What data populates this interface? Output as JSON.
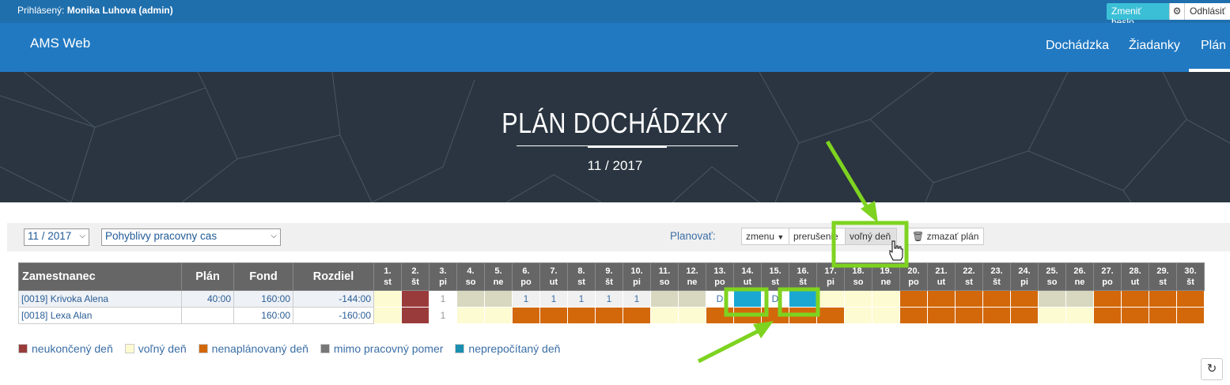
{
  "topbar": {
    "login_prefix": "Prihlásený:",
    "login_user": "Monika Luhova (admin)",
    "change_password": "Zmeniť heslo",
    "logout": "Odhlásiť"
  },
  "navbar": {
    "brand": "AMS Web",
    "items": [
      "Dochádzka",
      "Žiadanky",
      "Plán"
    ]
  },
  "hero": {
    "title": "PLÁN DOCHÁDZKY",
    "subtitle": "11 / 2017"
  },
  "filters": {
    "month": "11 / 2017",
    "schedule": "Pohyblivy pracovny cas",
    "plan_label": "Planovať:",
    "buttons": [
      "zmenu",
      "prerušenie",
      "voľný deň"
    ],
    "clear_plan": "zmazať plán"
  },
  "table": {
    "headers": {
      "employee": "Zamestnanec",
      "plan": "Plán",
      "fund": "Fond",
      "diff": "Rozdiel"
    },
    "days": [
      [
        "1.",
        "st"
      ],
      [
        "2.",
        "št"
      ],
      [
        "3.",
        "pi"
      ],
      [
        "4.",
        "so"
      ],
      [
        "5.",
        "ne"
      ],
      [
        "6.",
        "po"
      ],
      [
        "7.",
        "ut"
      ],
      [
        "8.",
        "st"
      ],
      [
        "9.",
        "št"
      ],
      [
        "10.",
        "pi"
      ],
      [
        "11.",
        "so"
      ],
      [
        "12.",
        "ne"
      ],
      [
        "13.",
        "po"
      ],
      [
        "14.",
        "ut"
      ],
      [
        "15.",
        "st"
      ],
      [
        "16.",
        "št"
      ],
      [
        "17.",
        "pi"
      ],
      [
        "18.",
        "so"
      ],
      [
        "19.",
        "ne"
      ],
      [
        "20.",
        "po"
      ],
      [
        "21.",
        "ut"
      ],
      [
        "22.",
        "st"
      ],
      [
        "23.",
        "št"
      ],
      [
        "24.",
        "pi"
      ],
      [
        "25.",
        "so"
      ],
      [
        "26.",
        "ne"
      ],
      [
        "27.",
        "po"
      ],
      [
        "28.",
        "ut"
      ],
      [
        "29.",
        "st"
      ],
      [
        "30.",
        "št"
      ]
    ],
    "rows": [
      {
        "name": "[0019] Krivoka Alena",
        "plan": "40:00",
        "fund": "160:00",
        "diff": "-144:00",
        "cells": [
          [
            "free",
            ""
          ],
          [
            "unf",
            ""
          ],
          [
            "val3",
            "1"
          ],
          [
            "grey",
            ""
          ],
          [
            "grey",
            ""
          ],
          [
            "hours",
            "1"
          ],
          [
            "hours",
            "1"
          ],
          [
            "hours",
            "1"
          ],
          [
            "hours",
            "1"
          ],
          [
            "hours",
            "1"
          ],
          [
            "grey",
            ""
          ],
          [
            "grey",
            ""
          ],
          [
            "d",
            "D"
          ],
          [
            "blue",
            ""
          ],
          [
            "d",
            "D"
          ],
          [
            "blue",
            ""
          ],
          [
            "free",
            ""
          ],
          [
            "free",
            ""
          ],
          [
            "free",
            ""
          ],
          [
            "unp",
            ""
          ],
          [
            "unp",
            ""
          ],
          [
            "unp",
            ""
          ],
          [
            "unp",
            ""
          ],
          [
            "unp",
            ""
          ],
          [
            "grey",
            ""
          ],
          [
            "grey",
            ""
          ],
          [
            "unp",
            ""
          ],
          [
            "unp",
            ""
          ],
          [
            "unp",
            ""
          ],
          [
            "unp",
            ""
          ]
        ]
      },
      {
        "name": "[0018] Lexa Alan",
        "plan": "",
        "fund": "160:00",
        "diff": "-160:00",
        "cells": [
          [
            "free",
            ""
          ],
          [
            "unf",
            ""
          ],
          [
            "val3",
            "1"
          ],
          [
            "free",
            ""
          ],
          [
            "free",
            ""
          ],
          [
            "unp",
            ""
          ],
          [
            "unp",
            ""
          ],
          [
            "unp",
            ""
          ],
          [
            "unp",
            ""
          ],
          [
            "unp",
            ""
          ],
          [
            "free",
            ""
          ],
          [
            "free",
            ""
          ],
          [
            "unp",
            ""
          ],
          [
            "unp",
            ""
          ],
          [
            "unp",
            ""
          ],
          [
            "unp",
            ""
          ],
          [
            "unp",
            ""
          ],
          [
            "free",
            ""
          ],
          [
            "free",
            ""
          ],
          [
            "unp",
            ""
          ],
          [
            "unp",
            ""
          ],
          [
            "unp",
            ""
          ],
          [
            "unp",
            ""
          ],
          [
            "unp",
            ""
          ],
          [
            "free",
            ""
          ],
          [
            "free",
            ""
          ],
          [
            "unp",
            ""
          ],
          [
            "unp",
            ""
          ],
          [
            "unp",
            ""
          ],
          [
            "unp",
            ""
          ]
        ]
      }
    ]
  },
  "legend": [
    {
      "label": "neukončený deň",
      "color": "#9a3b3b"
    },
    {
      "label": "voľný deň",
      "color": "#fdfbd1"
    },
    {
      "label": "nenaplánovaný deň",
      "color": "#d2680a"
    },
    {
      "label": "mimo pracovný pomer",
      "color": "#777777"
    },
    {
      "label": "neprepočítaný deň",
      "color": "#1a8fb0"
    }
  ],
  "colors": {
    "highlight": "#7ed320",
    "navbar": "#2179c2",
    "topbar": "#1f6fad"
  }
}
